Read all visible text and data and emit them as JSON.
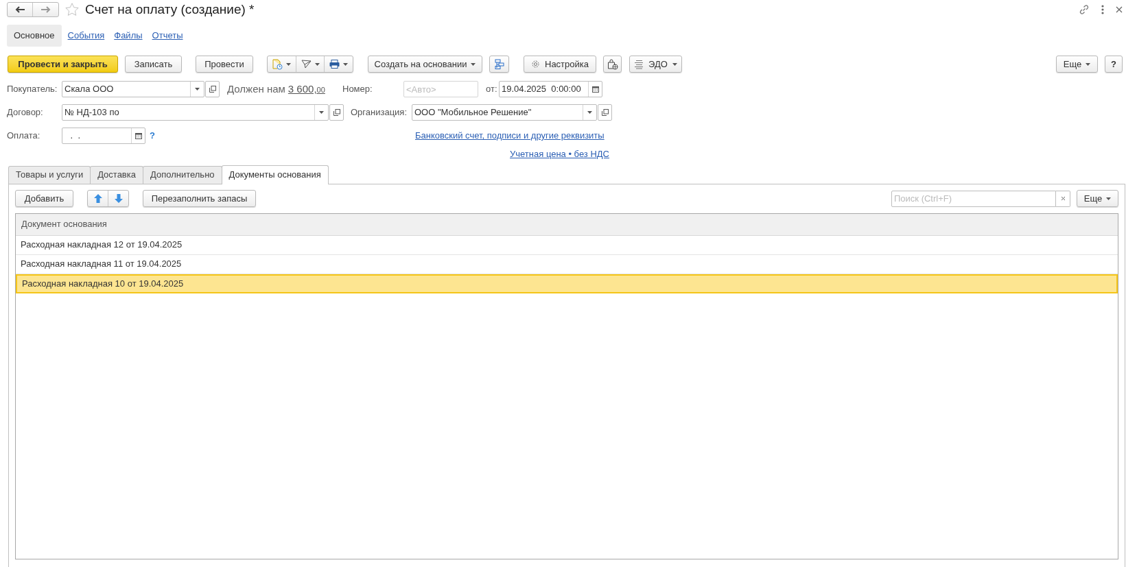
{
  "window": {
    "title": "Счет на оплату (создание) *",
    "favorite": false
  },
  "sections": [
    {
      "label": "Основное",
      "selected": true
    },
    {
      "label": "События",
      "selected": false
    },
    {
      "label": "Файлы",
      "selected": false
    },
    {
      "label": "Отчеты",
      "selected": false
    }
  ],
  "toolbar": {
    "post_and_close": "Провести и закрыть",
    "save": "Записать",
    "post": "Провести",
    "create_based_on": "Создать на основании",
    "settings": "Настройка",
    "edo": "ЭДО",
    "more": "Еще",
    "help": "?"
  },
  "fields": {
    "buyer": {
      "label": "Покупатель:",
      "value": "Скала ООО"
    },
    "debt": {
      "label": "Должен нам",
      "amount": "3 600,",
      "cents": "00"
    },
    "number": {
      "label": "Номер:",
      "placeholder": "<Авто>"
    },
    "date": {
      "label": "от:",
      "value": "19.04.2025  0:00:00"
    },
    "contract": {
      "label": "Договор:",
      "value": "№ НД-103 по"
    },
    "organization": {
      "label": "Организация:",
      "value": "ООО \"Мобильное Решение\""
    },
    "payment": {
      "label": "Оплата:",
      "value": " .  .",
      "help": "?"
    }
  },
  "links": [
    "Банковский счет, подписи и другие реквизиты",
    "Учетная цена • без НДС"
  ],
  "tabs": [
    {
      "label": "Товары и услуги",
      "selected": false
    },
    {
      "label": "Доставка",
      "selected": false
    },
    {
      "label": "Дополнительно",
      "selected": false
    },
    {
      "label": "Документы основания",
      "selected": true
    }
  ],
  "table_toolbar": {
    "add": "Добавить",
    "refill": "Перезаполнить запасы",
    "search_placeholder": "Поиск (Ctrl+F)",
    "more": "Еще"
  },
  "table": {
    "columns": [
      "Документ основания"
    ],
    "rows": [
      {
        "cells": [
          "Расходная накладная 12 от 19.04.2025"
        ],
        "selected": false
      },
      {
        "cells": [
          "Расходная накладная 11 от 19.04.2025"
        ],
        "selected": false
      },
      {
        "cells": [
          "Расходная накладная 10 от 19.04.2025"
        ],
        "selected": true
      }
    ]
  }
}
